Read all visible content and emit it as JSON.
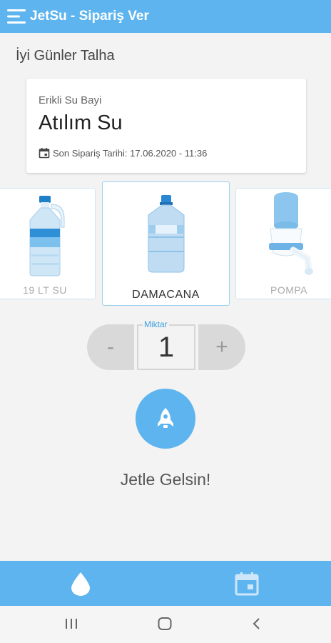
{
  "appbar": {
    "title": "JetSu - Sipariş Ver",
    "menu_icon": "menu-icon"
  },
  "greeting": "İyi Günler Talha",
  "dealer": {
    "subtitle": "Erikli Su Bayi",
    "name": "Atılım Su",
    "last_order": "Son Sipariş Tarihi: 17.06.2020 - 11:36",
    "calendar_icon": "calendar-icon"
  },
  "products": [
    {
      "label": "19 LT SU",
      "selected": false
    },
    {
      "label": "DAMACANA",
      "selected": true
    },
    {
      "label": "POMPA",
      "selected": false
    }
  ],
  "quantity": {
    "caption": "Miktar",
    "value": "1",
    "minus": "-",
    "plus": "+"
  },
  "order": {
    "button_icon": "rocket-icon",
    "label": "Jetle Gelsin!"
  },
  "bottom_nav": {
    "items": [
      "water-drop-icon",
      "calendar-icon"
    ]
  },
  "colors": {
    "primary": "#5eb4ee",
    "background": "#f3f3f3",
    "accent_text": "#3c9fe0"
  }
}
